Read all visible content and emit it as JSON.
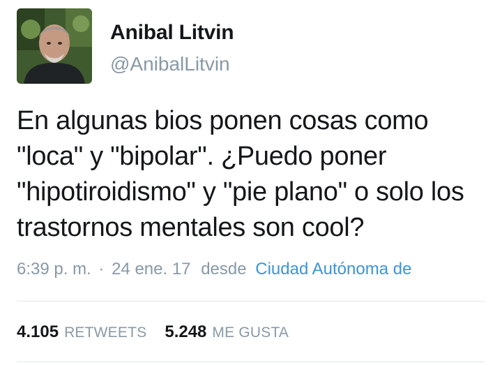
{
  "author": {
    "display_name": "Anibal Litvin",
    "handle": "@AnibalLitvin"
  },
  "tweet": {
    "text": "En algunas bios ponen cosas como\n\"loca\" y \"bipolar\". ¿Puedo poner\n\"hipotiroidismo\" y \"pie plano\" o solo los\ntrastornos mentales son cool?",
    "time": "6:39 p. m.",
    "separator": "·",
    "date": "24 ene. 17",
    "from_label": "desde",
    "location": "Ciudad Autónoma de"
  },
  "stats": {
    "retweets_count": "4.105",
    "retweets_label": "RETWEETS",
    "likes_count": "5.248",
    "likes_label": "ME GUSTA"
  },
  "colors": {
    "text": "#14171a",
    "muted": "#8899a6",
    "link": "#3b94d9",
    "divider": "#e1e8ed"
  }
}
